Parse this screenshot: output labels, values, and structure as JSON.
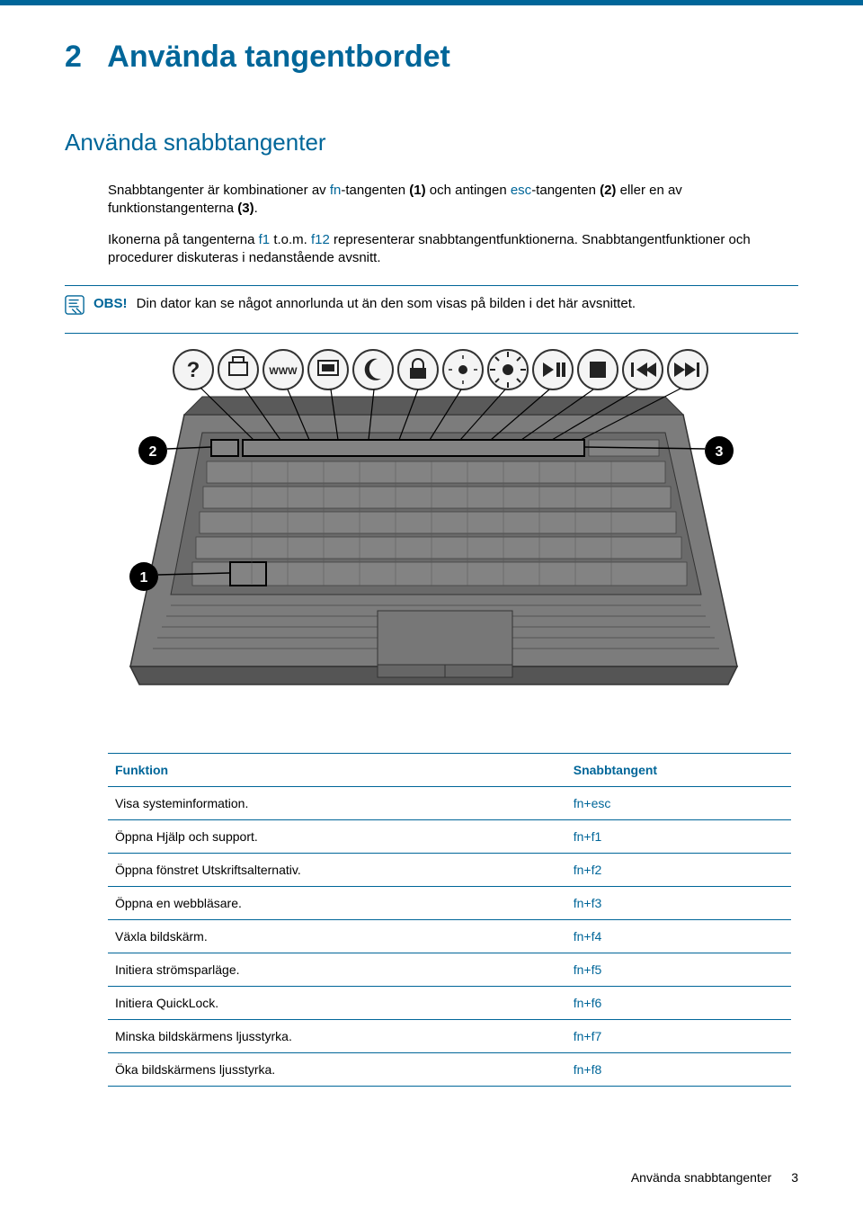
{
  "chapter": {
    "number": "2",
    "title": "Använda tangentbordet"
  },
  "section": {
    "title": "Använda snabbtangenter"
  },
  "paragraphs": {
    "p1_a": "Snabbtangenter är kombinationer av ",
    "p1_fn": "fn",
    "p1_b": "-tangenten ",
    "p1_b2": "(1)",
    "p1_c": " och antingen ",
    "p1_esc": "esc",
    "p1_d": "-tangenten ",
    "p1_d2": "(2)",
    "p1_e": " eller en av funktionstangenterna ",
    "p1_e2": "(3)",
    "p1_f": ".",
    "p2_a": "Ikonerna på tangenterna ",
    "p2_f1": "f1",
    "p2_b": " t.o.m. ",
    "p2_f12": "f12",
    "p2_c": " representerar snabbtangentfunktionerna. Snabbtangentfunktioner och procedurer diskuteras i nedanstående avsnitt."
  },
  "note": {
    "label": "OBS!",
    "text": "Din dator kan se något annorlunda ut än den som visas på bilden i det här avsnittet."
  },
  "table": {
    "headers": {
      "func": "Funktion",
      "key": "Snabbtangent"
    },
    "rows": [
      {
        "func": "Visa systeminformation.",
        "key": "fn+esc"
      },
      {
        "func": "Öppna Hjälp och support.",
        "key": "fn+f1"
      },
      {
        "func": "Öppna fönstret Utskriftsalternativ.",
        "key": "fn+f2"
      },
      {
        "func": "Öppna en webbläsare.",
        "key": "fn+f3"
      },
      {
        "func": "Växla bildskärm.",
        "key": "fn+f4"
      },
      {
        "func": "Initiera strömsparläge.",
        "key": "fn+f5"
      },
      {
        "func": "Initiera QuickLock.",
        "key": "fn+f6"
      },
      {
        "func": "Minska bildskärmens ljusstyrka.",
        "key": "fn+f7"
      },
      {
        "func": "Öka bildskärmens ljusstyrka.",
        "key": "fn+f8"
      }
    ]
  },
  "footer": {
    "text": "Använda snabbtangenter",
    "page": "3"
  },
  "callouts": {
    "c1": "1",
    "c2": "2",
    "c3": "3"
  }
}
